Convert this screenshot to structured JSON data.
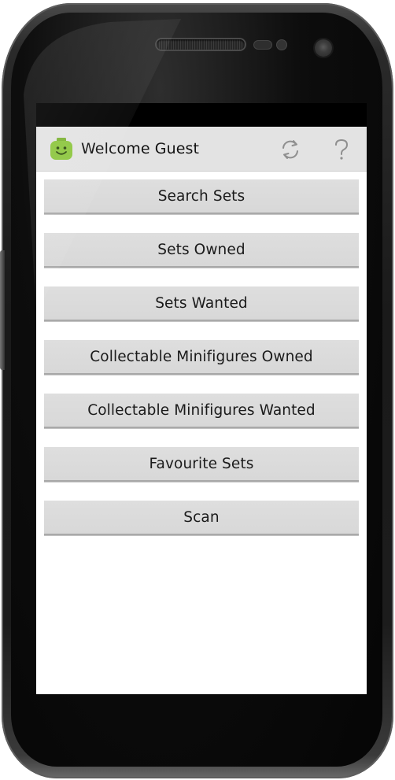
{
  "action_bar": {
    "title": "Welcome Guest",
    "app_icon": "lego-head-icon",
    "refresh_icon": "refresh-icon",
    "help_icon": "help-icon",
    "app_icon_color": "#8dc63f"
  },
  "menu": {
    "buttons": [
      {
        "label": "Search Sets"
      },
      {
        "label": "Sets Owned"
      },
      {
        "label": "Sets Wanted"
      },
      {
        "label": "Collectable Minifigures Owned"
      },
      {
        "label": "Collectable Minifigures Wanted"
      },
      {
        "label": "Favourite Sets"
      },
      {
        "label": "Scan"
      }
    ]
  },
  "colors": {
    "action_bar_bg": "#e3e3e3",
    "button_bg": "#d9d9d9",
    "device_body": "#1a1a1a"
  }
}
